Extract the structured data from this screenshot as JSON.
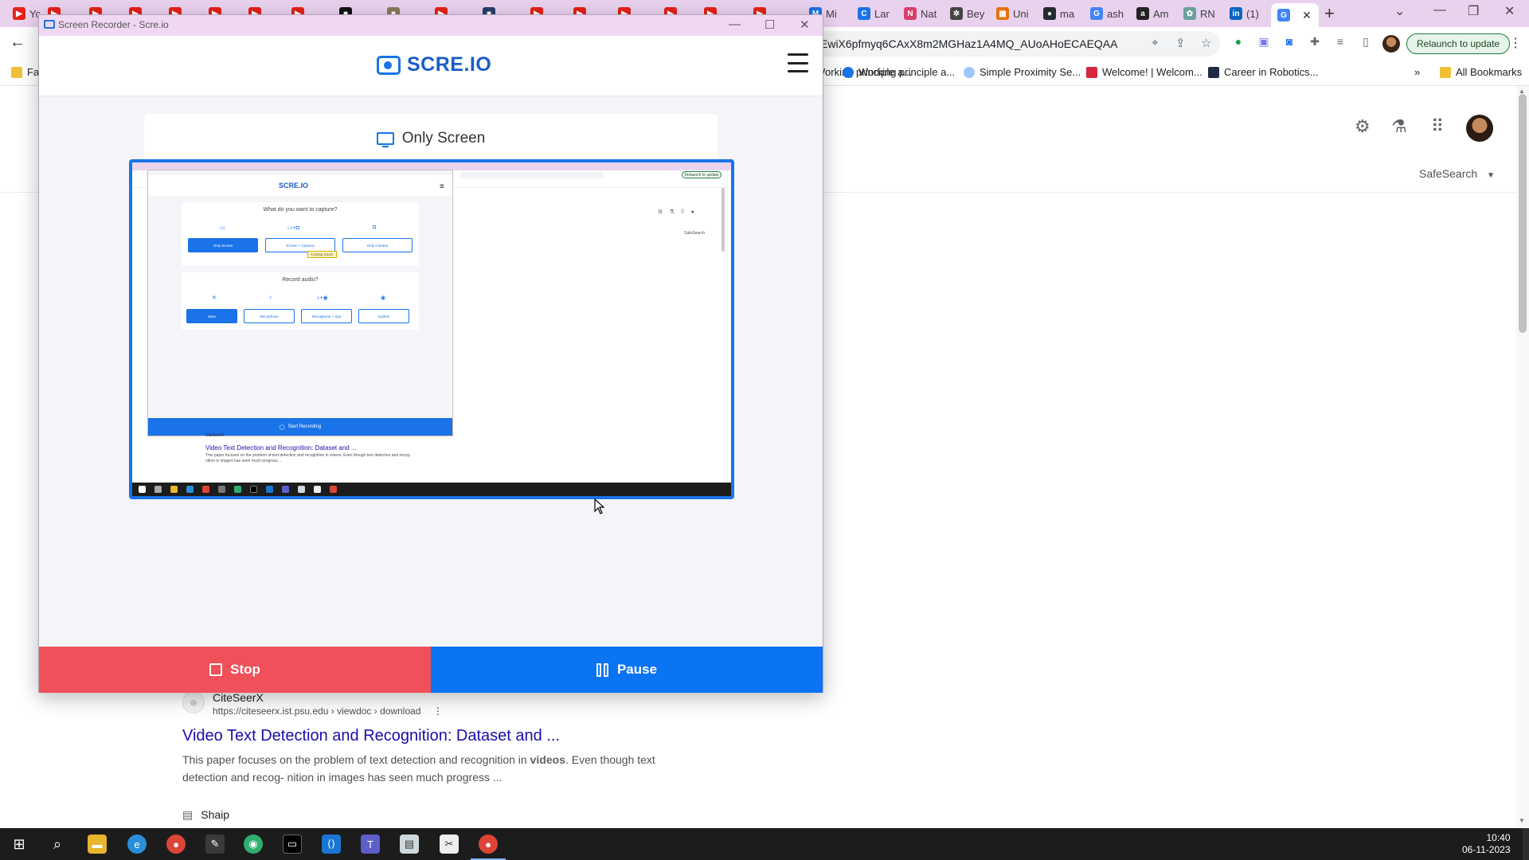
{
  "browser": {
    "tabs": [
      {
        "title": "Yo",
        "color": "#e62117"
      },
      {
        "title": "Mi",
        "color": "#1a73e8"
      },
      {
        "title": "Lar",
        "color": "#1a73e8"
      },
      {
        "title": "Nat",
        "color": "#d93f6b"
      },
      {
        "title": "Bey",
        "color": "#444444"
      },
      {
        "title": "Uni",
        "color": "#e8710a"
      },
      {
        "title": "ma",
        "color": "#24292f"
      },
      {
        "title": "ash",
        "color": "#4285f4"
      },
      {
        "title": "Am",
        "color": "#222222"
      },
      {
        "title": "RN",
        "color": "#6aa09c"
      },
      {
        "title": "(1)",
        "color": "#0a66c2"
      }
    ],
    "url": "EwiX6pfmyq6CAxX8m2MGHaz1A4MQ_AUoAHoECAEQAA",
    "relaunch_label": "Relaunch to update",
    "bookmarks": {
      "first": "Fa",
      "items": [
        "Working principle a...",
        "Simple Proximity Se...",
        "Welcome! | Welcom...",
        "Career in Robotics..."
      ],
      "all_bookmarks": "All Bookmarks"
    }
  },
  "google": {
    "safesearch": "SafeSearch",
    "result": {
      "site_name": "CiteSeerX",
      "url": "https://citeseerx.ist.psu.edu › viewdoc › download",
      "title": "Video Text Detection and Recognition: Dataset and ...",
      "snippet_before": "This paper focuses on the problem of text detection and recognition in ",
      "snippet_bold": "videos",
      "snippet_after": ". Even though text detection and recog- nition in images has seen much progress ..."
    },
    "next_result": "Shaip"
  },
  "recorder": {
    "window_title": "Screen Recorder - Scre.io",
    "logo": "SCRE.IO",
    "mode_label": "Only Screen",
    "stop_label": "Stop",
    "pause_label": "Pause",
    "preview": {
      "logo": "SCRE.IO",
      "question_capture": "What do you want to capture?",
      "capture_options": [
        "Only Screen",
        "Screen + Camera",
        "Only Camera"
      ],
      "coming_soon": "Coming Soon!",
      "question_audio": "Record audio?",
      "audio_options": [
        "Mute",
        "Microphone",
        "Microphone + Sys",
        "System"
      ],
      "start_label": "Start Recording",
      "result_site": "CiteSeerX",
      "result_title": "Video Text Detection and Recognition: Dataset and ...",
      "result_snippet": "This paper focuses on the problem of text detection and recognition in videos. Even though text detection and recog- nition in images has seen much progress ...",
      "relaunch": "Relaunch to update",
      "safesearch": "SafeSearch"
    }
  },
  "taskbar": {
    "time": "10:40",
    "date": "06-11-2023"
  }
}
